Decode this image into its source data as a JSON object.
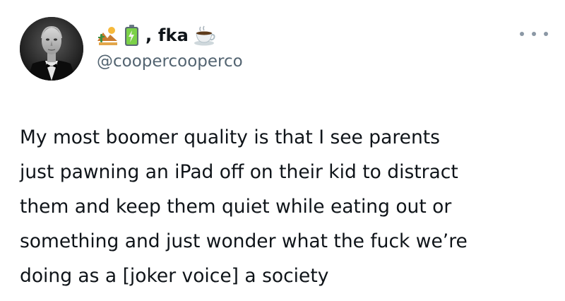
{
  "author": {
    "avatar_icon": "profile-photo",
    "name_emojis": [
      "desert-landscape-emoji",
      "battery-emoji"
    ],
    "name_text": ", fka",
    "name_trailing_emoji": "hot-beverage-emoji",
    "handle": "@coopercooperco"
  },
  "more_menu_icon": "more-horizontal-icon",
  "tweet": {
    "lines": [
      "My most boomer quality is that I see parents",
      "just pawning an iPad off on their kid to distract",
      "them and keep them quiet while eating out or",
      "something and just wonder what the fuck we’re",
      "doing as a [joker voice] a society"
    ]
  },
  "colors": {
    "text": "#0f1419",
    "secondary": "#536471",
    "background": "#ffffff"
  }
}
